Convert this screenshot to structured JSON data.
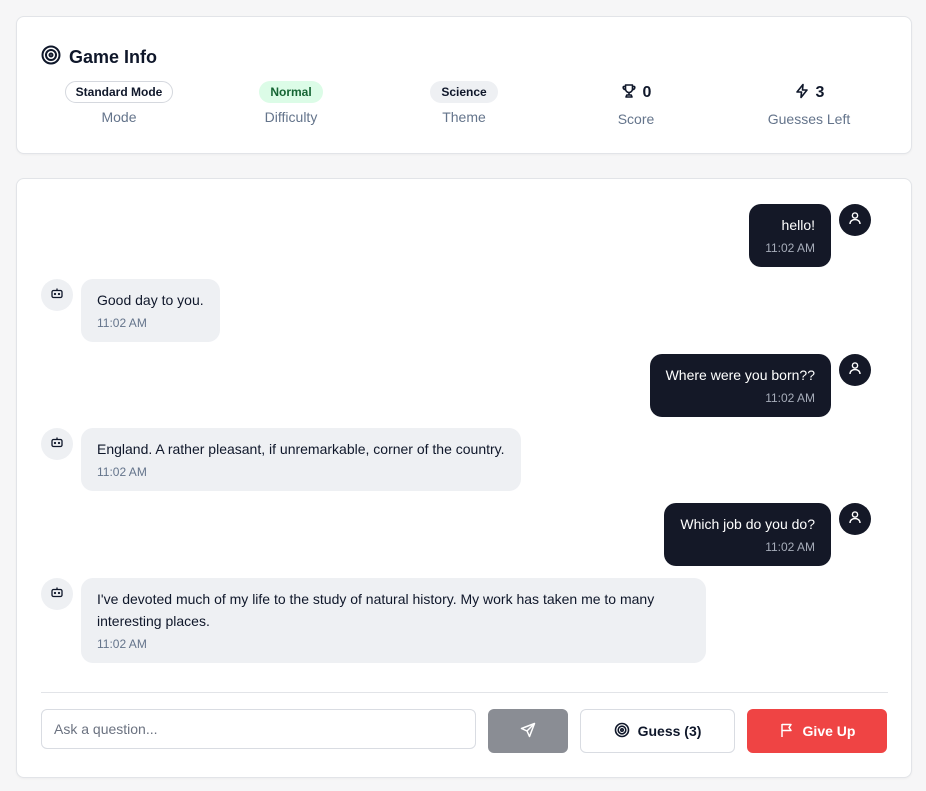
{
  "game_info": {
    "title": "Game Info",
    "title_icon": "target-icon",
    "stats": {
      "mode": {
        "value": "Standard Mode",
        "label": "Mode"
      },
      "difficulty": {
        "value": "Normal",
        "label": "Difficulty",
        "color": "#dcfce7"
      },
      "theme": {
        "value": "Science",
        "label": "Theme"
      },
      "score": {
        "value": "0",
        "label": "Score",
        "icon": "trophy-icon"
      },
      "guesses_left": {
        "value": "3",
        "label": "Guesses Left",
        "icon": "lightning-icon"
      }
    }
  },
  "chat": {
    "messages": [
      {
        "sender": "user",
        "text": "hello!",
        "time": "11:02 AM"
      },
      {
        "sender": "bot",
        "text": "Good day to you.",
        "time": "11:02 AM"
      },
      {
        "sender": "user",
        "text": "Where were you born??",
        "time": "11:02 AM"
      },
      {
        "sender": "bot",
        "text": "England. A rather pleasant, if unremarkable, corner of the country.",
        "time": "11:02 AM"
      },
      {
        "sender": "user",
        "text": "Which job do you do?",
        "time": "11:02 AM"
      },
      {
        "sender": "bot",
        "text": "I've devoted much of my life to the study of natural history. My work has taken me to many interesting places.",
        "time": "11:02 AM"
      }
    ]
  },
  "composer": {
    "placeholder": "Ask a question...",
    "value": "",
    "send_icon": "send-icon",
    "guess_label": "Guess (3)",
    "guess_icon": "target-icon",
    "give_up_label": "Give Up",
    "give_up_icon": "flag-icon"
  },
  "colors": {
    "user_bubble": "#141827",
    "bot_bubble": "#eef0f3",
    "give_up": "#ef4444",
    "send_disabled": "#8a8d94"
  }
}
